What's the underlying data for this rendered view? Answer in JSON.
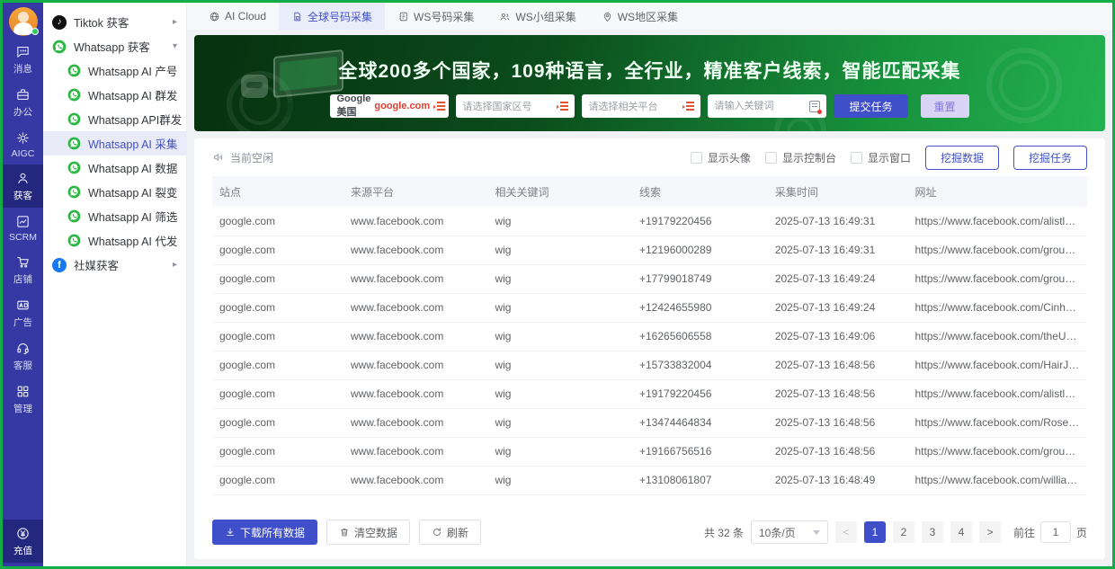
{
  "rail": {
    "items": [
      {
        "label": "消息"
      },
      {
        "label": "办公"
      },
      {
        "label": "AIGC"
      },
      {
        "label": "获客",
        "active": true
      },
      {
        "label": "SCRM"
      },
      {
        "label": "店铺"
      },
      {
        "label": "广告"
      },
      {
        "label": "客服"
      },
      {
        "label": "管理"
      }
    ],
    "bottom": {
      "label": "充值"
    }
  },
  "sidebar": {
    "tiktok_label": "Tiktok 获客",
    "whatsapp_label": "Whatsapp 获客",
    "whatsapp_children": [
      {
        "label": "Whatsapp AI 产号"
      },
      {
        "label": "Whatsapp AI 群发"
      },
      {
        "label": "Whatsapp API群发"
      },
      {
        "label": "Whatsapp AI 采集",
        "active": true
      },
      {
        "label": "Whatsapp AI 数据"
      },
      {
        "label": "Whatsapp AI 裂变"
      },
      {
        "label": "Whatsapp AI 筛选"
      },
      {
        "label": "Whatsapp AI 代发"
      }
    ],
    "social_label": "社媒获客"
  },
  "tabs": {
    "ai_cloud": "AI Cloud",
    "global_collect": "全球号码采集",
    "ws_number": "WS号码采集",
    "ws_group": "WS小组采集",
    "ws_region": "WS地区采集"
  },
  "banner": {
    "title": "全球200多个国家，109种语言，全行业，精准客户线索，智能匹配采集",
    "site_prefix": "Google 美国",
    "site_highlight": "google.com",
    "country_placeholder": "请选择国家区号",
    "platform_placeholder": "请选择相关平台",
    "keyword_placeholder": "请输入关键词",
    "submit_label": "提交任务",
    "reset_label": "重置"
  },
  "toolbar": {
    "status": "当前空闲",
    "checkboxes": [
      {
        "label": "显示头像"
      },
      {
        "label": "显示控制台"
      },
      {
        "label": "显示窗口"
      }
    ],
    "mine_data_label": "挖掘数据",
    "mine_task_label": "挖掘任务"
  },
  "table": {
    "headers": [
      "站点",
      "来源平台",
      "相关关键词",
      "线索",
      "采集时间",
      "网址"
    ],
    "rows": [
      {
        "site": "google.com",
        "platform": "www.facebook.com",
        "keyword": "wig",
        "lead": "+19179220456",
        "time": "2025-07-13 16:49:31",
        "url": "https://www.facebook.com/alistlace..."
      },
      {
        "site": "google.com",
        "platform": "www.facebook.com",
        "keyword": "wig",
        "lead": "+12196000289",
        "time": "2025-07-13 16:49:31",
        "url": "https://www.facebook.com/groups/..."
      },
      {
        "site": "google.com",
        "platform": "www.facebook.com",
        "keyword": "wig",
        "lead": "+17799018749",
        "time": "2025-07-13 16:49:24",
        "url": "https://www.facebook.com/groups/..."
      },
      {
        "site": "google.com",
        "platform": "www.facebook.com",
        "keyword": "wig",
        "lead": "+12424655980",
        "time": "2025-07-13 16:49:24",
        "url": "https://www.facebook.com/Cinhairb..."
      },
      {
        "site": "google.com",
        "platform": "www.facebook.com",
        "keyword": "wig",
        "lead": "+16265606558",
        "time": "2025-07-13 16:49:06",
        "url": "https://www.facebook.com/theUstar..."
      },
      {
        "site": "google.com",
        "platform": "www.facebook.com",
        "keyword": "wig",
        "lead": "+15733832004",
        "time": "2025-07-13 16:48:56",
        "url": "https://www.facebook.com/HairJusti..."
      },
      {
        "site": "google.com",
        "platform": "www.facebook.com",
        "keyword": "wig",
        "lead": "+19179220456",
        "time": "2025-07-13 16:48:56",
        "url": "https://www.facebook.com/alistlace..."
      },
      {
        "site": "google.com",
        "platform": "www.facebook.com",
        "keyword": "wig",
        "lead": "+13474464834",
        "time": "2025-07-13 16:48:56",
        "url": "https://www.facebook.com/RoseWi..."
      },
      {
        "site": "google.com",
        "platform": "www.facebook.com",
        "keyword": "wig",
        "lead": "+19166756516",
        "time": "2025-07-13 16:48:56",
        "url": "https://www.facebook.com/groups/..."
      },
      {
        "site": "google.com",
        "platform": "www.facebook.com",
        "keyword": "wig",
        "lead": "+13108061807",
        "time": "2025-07-13 16:48:49",
        "url": "https://www.facebook.com/williams..."
      }
    ]
  },
  "footer": {
    "download_label": "下载所有数据",
    "clear_label": "清空数据",
    "refresh_label": "刷新",
    "total": "共 32 条",
    "per_page": "10条/页",
    "prev": "<",
    "next": ">",
    "pages": [
      {
        "label": "1",
        "active": true
      },
      {
        "label": "2"
      },
      {
        "label": "3"
      },
      {
        "label": "4"
      }
    ],
    "goto_label": "前往",
    "goto_value": "1",
    "goto_suffix": "页"
  },
  "colors": {
    "accent_indigo": "#3f4ec9",
    "rail_bg": "#3639a4",
    "banner_green": "#17913c",
    "frame_green": "#13ad47",
    "highlight_red": "#e23c2e",
    "whatsapp_green": "#2cb742"
  }
}
